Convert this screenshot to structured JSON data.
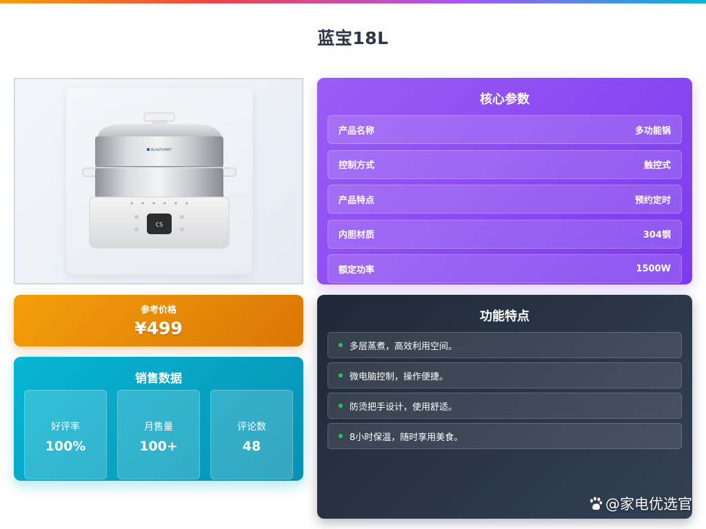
{
  "page": {
    "title": "蓝宝18L"
  },
  "product_image": {
    "alt": "BLAUPUNKT 多层蒸煮锅",
    "brand_mark": "BLAUPUNKT",
    "display_text": "CS"
  },
  "params": {
    "title": "核心参数",
    "rows": [
      {
        "label": "产品名称",
        "value": "多功能锅"
      },
      {
        "label": "控制方式",
        "value": "触控式"
      },
      {
        "label": "产品特点",
        "value": "预约定时"
      },
      {
        "label": "内胆材质",
        "value": "304钢"
      },
      {
        "label": "额定功率",
        "value": "1500W"
      }
    ]
  },
  "price": {
    "label": "参考价格",
    "value": "¥499"
  },
  "sales": {
    "title": "销售数据",
    "stats": [
      {
        "label": "好评率",
        "value": "100%"
      },
      {
        "label": "月售量",
        "value": "100+"
      },
      {
        "label": "评论数",
        "value": "48"
      }
    ]
  },
  "features": {
    "title": "功能特点",
    "items": [
      "多层蒸煮，高效利用空间。",
      "微电脑控制，操作便捷。",
      "防烫把手设计，使用舒适。",
      "8小时保温，随时享用美食。"
    ]
  },
  "watermark": {
    "text": "@家电优选官",
    "icon": "paw-icon"
  },
  "colors": {
    "purple": "#7c3aed",
    "orange": "#d97706",
    "cyan": "#0891b2",
    "dark": "#1f2937",
    "bullet": "#22c55e"
  }
}
